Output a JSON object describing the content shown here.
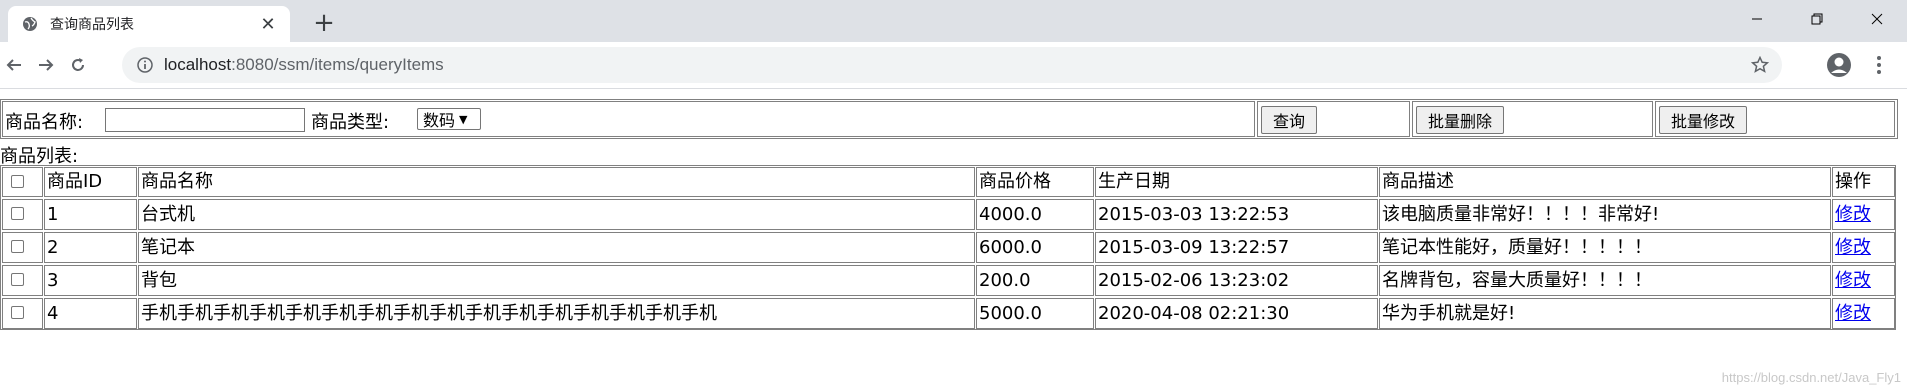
{
  "browser": {
    "tab_title": "查询商品列表",
    "url_host": "localhost",
    "url_rest": ":8080/ssm/items/queryItems"
  },
  "query": {
    "name_label": "商品名称:",
    "name_value": "",
    "type_label": "商品类型:",
    "type_selected": "数码",
    "search_button": "查询",
    "batch_delete_button": "批量删除",
    "batch_edit_button": "批量修改"
  },
  "list_caption": "商品列表:",
  "table": {
    "headers": [
      "商品ID",
      "商品名称",
      "商品价格",
      "生产日期",
      "商品描述",
      "操作"
    ],
    "rows": [
      {
        "id": "1",
        "name": "台式机",
        "price": "4000.0",
        "date": "2015-03-03 13:22:53",
        "desc": "该电脑质量非常好！！！！非常好!",
        "action": "修改"
      },
      {
        "id": "2",
        "name": "笔记本",
        "price": "6000.0",
        "date": "2015-03-09 13:22:57",
        "desc": "笔记本性能好，质量好！！！！！",
        "action": "修改"
      },
      {
        "id": "3",
        "name": "背包",
        "price": "200.0",
        "date": "2015-02-06 13:23:02",
        "desc": "名牌背包，容量大质量好！！！！",
        "action": "修改"
      },
      {
        "id": "4",
        "name": "手机手机手机手机手机手机手机手机手机手机手机手机手机手机手机手机",
        "price": "5000.0",
        "date": "2020-04-08 02:21:30",
        "desc": "华为手机就是好!",
        "action": "修改"
      }
    ]
  },
  "watermark": "https://blog.csdn.net/Java_Fly1"
}
